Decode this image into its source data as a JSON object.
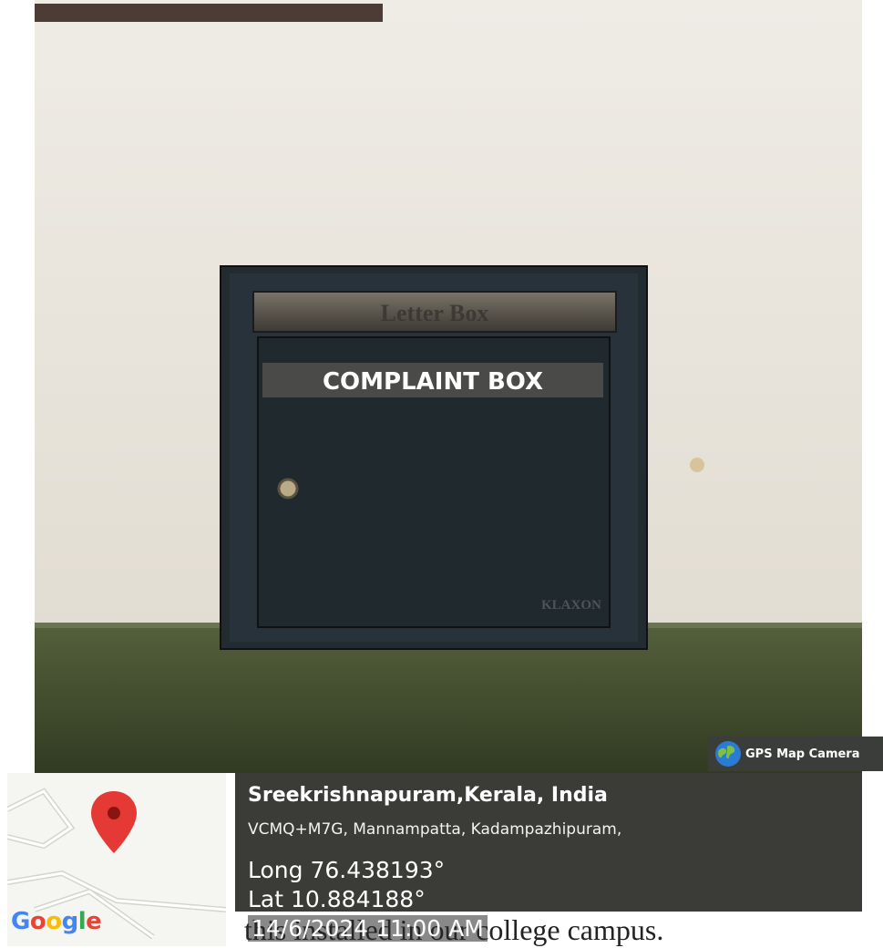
{
  "photo": {
    "label_plate": "Letter Box",
    "box_label": "COMPLAINT BOX",
    "brand": "KLAXON"
  },
  "gps": {
    "app_name": "GPS Map Camera",
    "map_logo": "Google",
    "place_title": "Sreekrishnapuram,Kerala, India",
    "address": "VCMQ+M7G, Mannampatta, Kadampazhipuram,",
    "longitude": "Long 76.438193°",
    "latitude": "Lat 10.884188°",
    "timestamp": "14/6/2024 11:00 AM"
  },
  "background_caption": "this installed in our college campus.",
  "colors": {
    "wall": "#e9e5dc",
    "table": "#3f4a2c",
    "box": "#263136",
    "panel": "#3b3b37",
    "pin": "#e53935"
  }
}
